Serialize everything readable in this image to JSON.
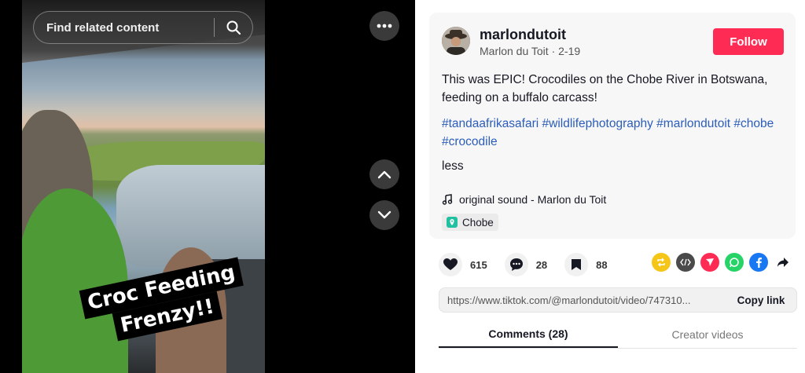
{
  "search": {
    "placeholder": "Find related content"
  },
  "video": {
    "caption_line1": "Croc Feeding",
    "caption_line2": "Frenzy!!"
  },
  "post": {
    "username": "marlondutoit",
    "display_name": "Marlon du Toit",
    "date": "2-19",
    "follow_label": "Follow",
    "description": "This was EPIC! Crocodiles on the Chobe River in Botswana, feeding on a buffalo carcass!",
    "hashtags": [
      "#tandaafrikasafari",
      "#wildlifephotography",
      "#marlondutoit",
      "#chobe",
      "#crocodile"
    ],
    "less_label": "less",
    "sound": "original sound - Marlon du Toit",
    "location": "Chobe"
  },
  "stats": {
    "likes": "615",
    "comments": "28",
    "saves": "88"
  },
  "link": {
    "url": "https://www.tiktok.com/@marlondutoit/video/747310...",
    "copy_label": "Copy link"
  },
  "tabs": [
    {
      "label": "Comments (28)"
    },
    {
      "label": "Creator videos"
    }
  ],
  "colors": {
    "accent": "#fe2c55",
    "hashtag": "#2b5db9"
  }
}
